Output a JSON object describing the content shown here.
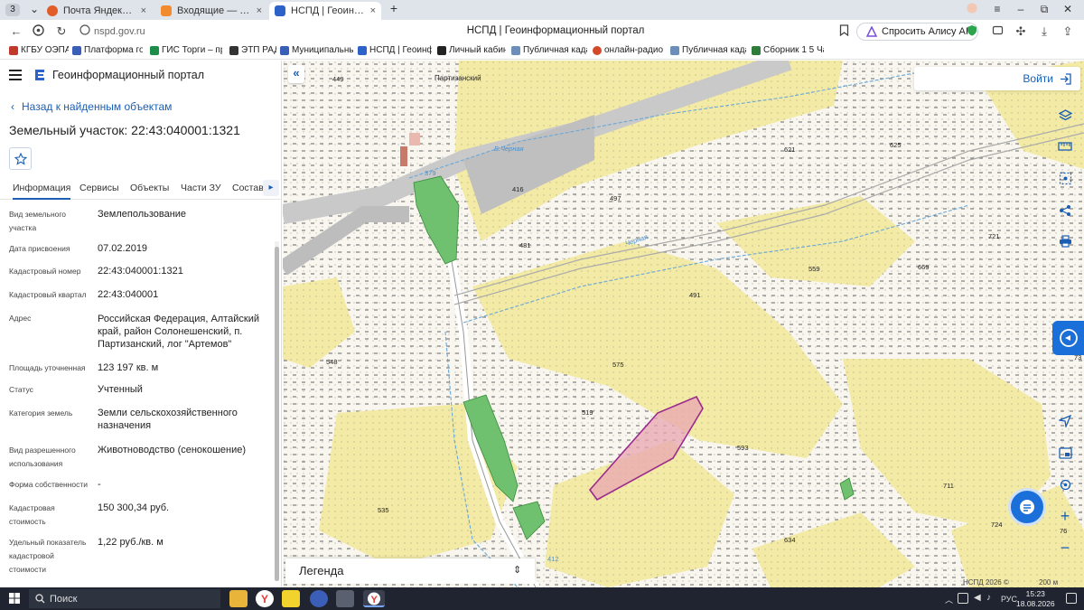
{
  "browser": {
    "tab_count": "3",
    "tabs": [
      {
        "title": "Почта Яндекс 360 — бесп",
        "favicon_color": "#e25c2a"
      },
      {
        "title": "Входящие — Яндекс Почта",
        "favicon_color": "#f28a2e"
      },
      {
        "title": "НСПД | Геоинформацио",
        "favicon_color": "#2d63c8",
        "active": true
      }
    ],
    "new_tab": "+",
    "url": "nspd.gov.ru",
    "page_title": "НСПД | Геоинформационный портал",
    "alice_label": "Спросить Алису AI",
    "bookmarks": [
      {
        "label": "КГБУ ОЭПАК",
        "color": "#c0392b"
      },
      {
        "label": "Платформа госуд",
        "color": "#3b5fb8"
      },
      {
        "label": "ГИС Торги – прод",
        "color": "#1b8f4a"
      },
      {
        "label": "ЭТП РАД",
        "color": "#333333"
      },
      {
        "label": "Муниципальный",
        "color": "#3b5fb8"
      },
      {
        "label": "НСПД | Геоинфор",
        "color": "#2d63c8"
      },
      {
        "label": "Личный кабинет",
        "color": "#222222"
      },
      {
        "label": "Публичная кадас",
        "color": "#6b8fb8"
      },
      {
        "label": "онлайн-радио сл",
        "color": "#d24a2a"
      },
      {
        "label": "Публичная кадас",
        "color": "#6b8fb8"
      },
      {
        "label": "Сборник 1 5 Часа",
        "color": "#2f7d3a"
      }
    ]
  },
  "panel": {
    "portal_title": "Геоинформационный портал",
    "back_link": "Назад к найденным объектам",
    "parcel_title": "Земельный участок: 22:43:040001:1321",
    "tabs": [
      "Информация",
      "Сервисы",
      "Объекты",
      "Части ЗУ",
      "Состав"
    ],
    "active_tab": "Информация",
    "fields": [
      {
        "label": "Вид земельного участка",
        "value": "Землепользование"
      },
      {
        "label": "Дата присвоения",
        "value": "07.02.2019"
      },
      {
        "label": "Кадастровый номер",
        "value": "22:43:040001:1321"
      },
      {
        "label": "Кадастровый квартал",
        "value": "22:43:040001"
      },
      {
        "label": "Адрес",
        "value": "Российская Федерация, Алтайский край, район Солонешенский, п. Партизанский, лог \"Артемов\""
      },
      {
        "label": "Площадь уточненная",
        "value": "123 197 кв. м"
      },
      {
        "label": "Статус",
        "value": "Учтенный"
      },
      {
        "label": "Категория земель",
        "value": "Земли сельскохозяйственного назначения"
      },
      {
        "label": "Вид разрешенного использования",
        "value": "Животноводство (сенокошение)"
      },
      {
        "label": "Форма собственности",
        "value": "-"
      },
      {
        "label": "Кадастровая стоимость",
        "value": "150 300,34 руб."
      },
      {
        "label": "Удельный показатель кадастровой стоимости",
        "value": "1,22 руб./кв. м"
      }
    ]
  },
  "map": {
    "login_label": "Войти",
    "legend_title": "Легенда",
    "copyright": "НСПД 2026 ©",
    "scale": "200 м",
    "place_name": "Партизанский",
    "river_name": "Б.Черная",
    "river_name_2": "Черная",
    "elevations": [
      "449",
      "416",
      "497",
      "621",
      "625",
      "481",
      "491",
      "559",
      "669",
      "721",
      "548",
      "575",
      "519",
      "593",
      "535",
      "634",
      "711",
      "724",
      "379",
      "559",
      "76",
      "73",
      "412"
    ],
    "colors": {
      "meadow": "#f3eaa6",
      "forest": "#6fc06f",
      "parcel_fill": "#e8a6b0",
      "parcel_stroke": "#9b2a8e",
      "road": "#c8c8c8",
      "accent": "#1a5fb4"
    }
  },
  "taskbar": {
    "search_label": "Поиск",
    "language": "РУС",
    "time": "15:23",
    "date": "18.08.2026"
  }
}
